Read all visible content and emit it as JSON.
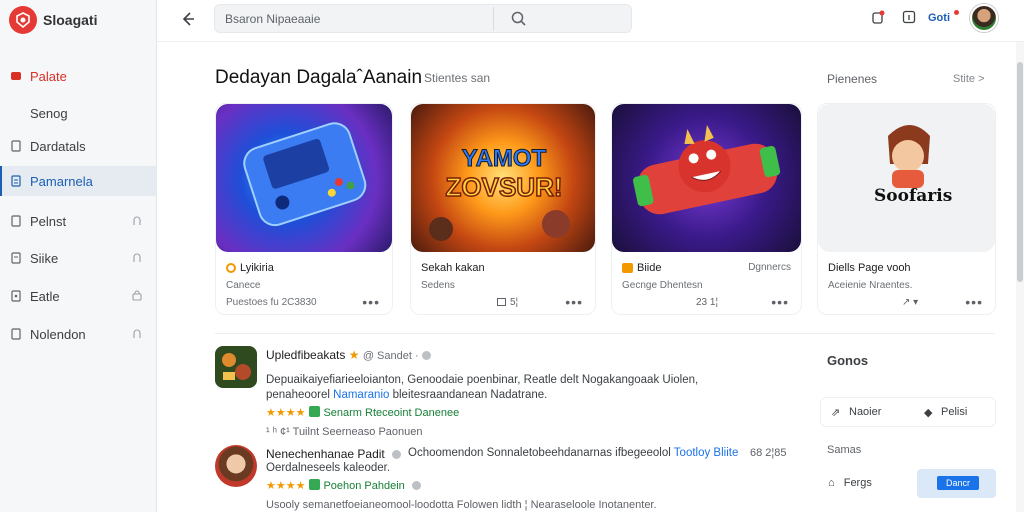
{
  "brand": {
    "name": "Sloagati"
  },
  "sidebar": {
    "items": [
      {
        "label": "Palate",
        "icon": "square-icon"
      },
      {
        "label": "Senog",
        "icon": ""
      },
      {
        "label": "Dardatals",
        "icon": "doc-icon"
      },
      {
        "label": "Pamarnela",
        "icon": "list-icon"
      },
      {
        "label": "Pelnst",
        "icon": "doc-icon"
      },
      {
        "label": "Siike",
        "icon": "doc-icon"
      },
      {
        "label": "Eatle",
        "icon": "doc-icon"
      },
      {
        "label": "Nolendon",
        "icon": "doc-icon"
      }
    ]
  },
  "topbar": {
    "search_placeholder": "Bsaron Nipaeaaie",
    "user_label": "Goti"
  },
  "section": {
    "title": "Dedayan DagalaˆAanain",
    "subtitle": "Stientes san",
    "right_label": "Pienenes",
    "more_label": "Stite >"
  },
  "cards": [
    {
      "title": "Lyikiria",
      "right": "",
      "sub": "Canece",
      "meta": "Puestoes fu 2C3830",
      "count": "",
      "thumb_text": ""
    },
    {
      "title": "Sekah kakan",
      "right": "",
      "sub": "Sedens",
      "meta": "",
      "count": "5¦",
      "thumb_text": "YAMOT ZOVSUR!"
    },
    {
      "title": "Biide",
      "right": "Dgnnercs",
      "sub": "Gecnge Dhentesn",
      "meta": "",
      "count": "23 1¦",
      "thumb_text": ""
    },
    {
      "title": "Diells Page vooh",
      "right": "",
      "sub": "Aceienie Nraentes.",
      "meta": "",
      "count": "",
      "thumb_text": "Soofaris"
    }
  ],
  "list": [
    {
      "title": "Upledfibeakats",
      "tag": "@ Sandet ·",
      "desc1": "Depuaikaiyefiarieeloianton, Genoodaie poenbinar, Reatle delt Nogakangoaak Uiolen,",
      "desc2a": "penaheoorel ",
      "desc2b": "Namaranio",
      "desc2c": " bleitesraandanean Nadatrane.",
      "stars": "★★★★",
      "green_text": "Senarm Rteceoint Danenee",
      "meta": "¹  h  ¢¹  Tuilnt Seerneaso Paonuen",
      "side": ""
    },
    {
      "title": "Nenechenhanae Padit",
      "tag": "",
      "desc1": "Ochoomendon Sonnaletobeehdanarnas ifbegeeolol",
      "desc1_blue": "Tootloy Bliite",
      "desc2": "Oerdalneseels kaleoder.",
      "stars": "★★★★",
      "green_text": "Poehon Pahdein",
      "meta": "Usooly semanetfoeianeomool-loodotta Folowen lidth ¦ Nearaseloole Inotanenter.",
      "side": "68 2¦85"
    }
  ],
  "right_panel": {
    "title": "Gonos",
    "row_left": "Naoier",
    "row_right": "Pelisi",
    "section2": "Samas",
    "figs": "Fergs",
    "button": "Dancr"
  }
}
